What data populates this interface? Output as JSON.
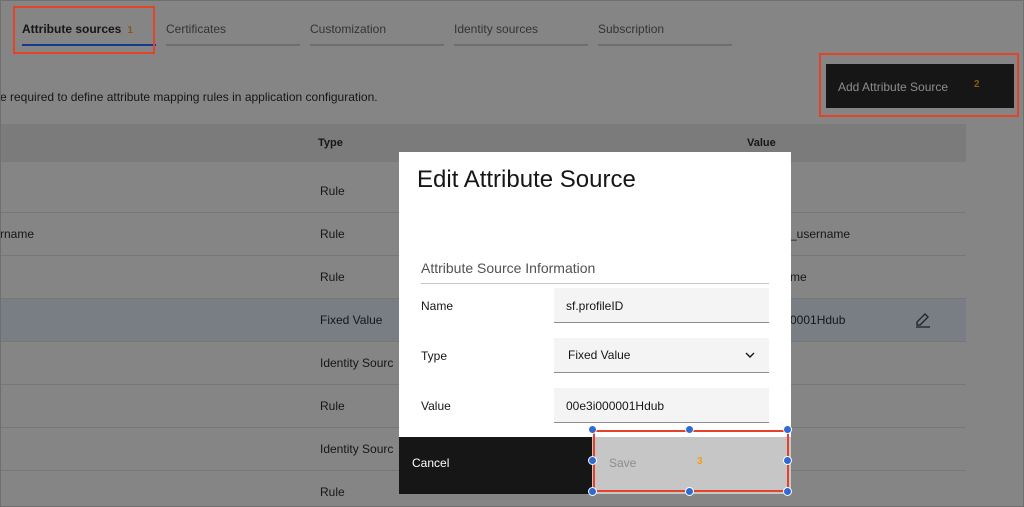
{
  "tabs": [
    {
      "label": "Attribute sources",
      "badge": "1",
      "active": true
    },
    {
      "label": "Certificates",
      "active": false
    },
    {
      "label": "Customization",
      "active": false
    },
    {
      "label": "Identity sources",
      "active": false
    },
    {
      "label": "Subscription",
      "active": false
    }
  ],
  "page": {
    "description": "e required to define attribute mapping rules in application configuration.",
    "add_button_label": "Add Attribute Source",
    "add_button_badge": "2"
  },
  "table": {
    "columns": [
      "Type",
      "Value"
    ],
    "rows": [
      {
        "name": "",
        "type": "Rule",
        "value": ""
      },
      {
        "name": "rname",
        "type": "Rule",
        "value": "_username"
      },
      {
        "name": "",
        "type": "Rule",
        "value": "me"
      },
      {
        "name": "",
        "type": "Fixed Value",
        "value": "0001Hdub"
      },
      {
        "name": "",
        "type": "Identity Sourc",
        "value": ""
      },
      {
        "name": "",
        "type": "Rule",
        "value": ""
      },
      {
        "name": "",
        "type": "Identity Sourc",
        "value": ""
      },
      {
        "name": "",
        "type": "Rule",
        "value": ""
      }
    ]
  },
  "modal": {
    "title": "Edit Attribute Source",
    "section": "Attribute Source Information",
    "name_label": "Name",
    "name_value": "sf.profileID",
    "type_label": "Type",
    "type_value": "Fixed Value",
    "value_label": "Value",
    "value_value": "00e3i000001Hdub",
    "cancel_label": "Cancel",
    "save_label": "Save",
    "save_badge": "3"
  },
  "colors": {
    "annotation": "#e2432a",
    "badge": "#f1a10f",
    "selection_handle": "#2f6bd3"
  }
}
